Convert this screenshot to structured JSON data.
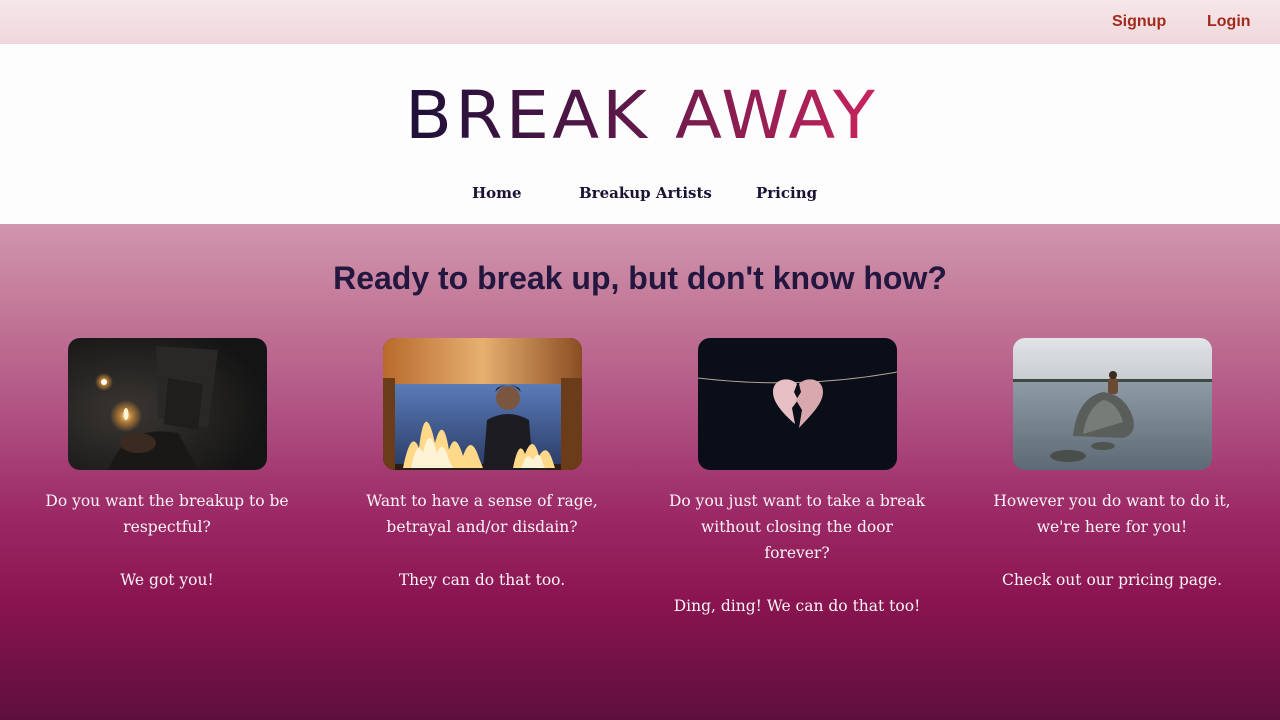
{
  "auth": {
    "signup_label": "Signup",
    "login_label": "Login"
  },
  "brand": {
    "part1": "BREAK",
    "part2": "AWAY"
  },
  "nav": [
    {
      "label": "Home"
    },
    {
      "label": "Breakup Artists"
    },
    {
      "label": "Pricing"
    }
  ],
  "hero": {
    "title": "Ready to break up, but don't know how?"
  },
  "cards": [
    {
      "text": "Do you want the breakup to be respectful?",
      "follow_up": "We got you!",
      "image": "lit-match-photo"
    },
    {
      "text": "Want to have a sense of rage, betrayal and/or disdain?",
      "follow_up": "They can do that too.",
      "image": "man-behind-fire-photo"
    },
    {
      "text": "Do you just want to take a break without closing the door forever?",
      "follow_up": "Ding, ding! We can do that too!",
      "image": "broken-heart-on-string-photo"
    },
    {
      "text": "However you do want to do it, we're here for you!",
      "follow_up": "Check out our pricing page.",
      "image": "person-on-rock-in-lake-photo"
    }
  ],
  "colors": {
    "accent_link": "#a12a1c",
    "nav_text": "#1c1233",
    "logo_start": "#1d1038",
    "logo_end": "#c8245e",
    "hero_title": "#24173f"
  }
}
